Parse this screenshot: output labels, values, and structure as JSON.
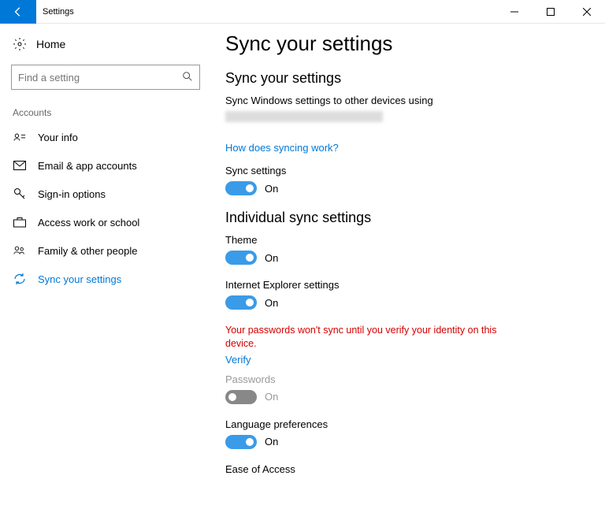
{
  "window": {
    "title": "Settings"
  },
  "sidebar": {
    "home": "Home",
    "search_placeholder": "Find a setting",
    "category": "Accounts",
    "items": [
      {
        "label": "Your info"
      },
      {
        "label": "Email & app accounts"
      },
      {
        "label": "Sign-in options"
      },
      {
        "label": "Access work or school"
      },
      {
        "label": "Family & other people"
      },
      {
        "label": "Sync your settings"
      }
    ]
  },
  "main": {
    "title": "Sync your settings",
    "section1_title": "Sync your settings",
    "desc": "Sync Windows settings to other devices using",
    "how_link": "How does syncing work?",
    "sync_settings_label": "Sync settings",
    "section2_title": "Individual sync settings",
    "toggles": {
      "theme": {
        "label": "Theme",
        "state": "On"
      },
      "ie": {
        "label": "Internet Explorer settings",
        "state": "On"
      },
      "passwords": {
        "label": "Passwords",
        "state": "On"
      },
      "language": {
        "label": "Language preferences",
        "state": "On"
      },
      "ease": {
        "label": "Ease of Access"
      }
    },
    "state_on": "On",
    "warning": "Your passwords won't sync until you verify your identity on this device.",
    "verify_link": "Verify"
  }
}
